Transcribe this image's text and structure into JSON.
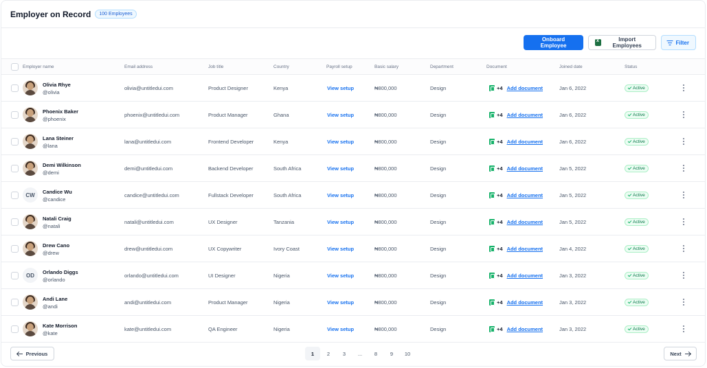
{
  "header": {
    "title": "Employer on Record",
    "badge": "100 Employees"
  },
  "toolbar": {
    "onboard_label": "Onboard Employee",
    "import_label": "Import Employees",
    "filter_label": "Filter"
  },
  "columns": {
    "employer_name": "Employer name",
    "email": "Email address",
    "job_title": "Job title",
    "country": "Country",
    "payroll": "Payroll setup",
    "salary": "Basic salary",
    "department": "Department",
    "document": "Document",
    "joined": "Joined date",
    "status": "Status"
  },
  "rows": [
    {
      "name": "Olivia Rhye",
      "handle": "@olivia",
      "avatar": "photo",
      "initials": "",
      "email": "olivia@untitledui.com",
      "job": "Product Designer",
      "country": "Kenya",
      "payroll": "View setup",
      "salary": "₦800,000",
      "department": "Design",
      "doc_count": "+4",
      "doc_link": "Add document",
      "joined": "Jan 6, 2022",
      "status": "Active"
    },
    {
      "name": "Phoenix Baker",
      "handle": "@phoenix",
      "avatar": "photo",
      "initials": "",
      "email": "phoenix@untitledui.com",
      "job": "Product Manager",
      "country": "Ghana",
      "payroll": "View setup",
      "salary": "₦800,000",
      "department": "Design",
      "doc_count": "+4",
      "doc_link": "Add document",
      "joined": "Jan 6, 2022",
      "status": "Active"
    },
    {
      "name": "Lana Steiner",
      "handle": "@lana",
      "avatar": "photo",
      "initials": "",
      "email": "lana@untitledui.com",
      "job": "Frontend Developer",
      "country": "Kenya",
      "payroll": "View setup",
      "salary": "₦800,000",
      "department": "Design",
      "doc_count": "+4",
      "doc_link": "Add document",
      "joined": "Jan 6, 2022",
      "status": "Active"
    },
    {
      "name": "Demi Wilkinson",
      "handle": "@demi",
      "avatar": "photo",
      "initials": "",
      "email": "demi@untitledui.com",
      "job": "Backend Developer",
      "country": "South Africa",
      "payroll": "View setup",
      "salary": "₦800,000",
      "department": "Design",
      "doc_count": "+4",
      "doc_link": "Add document",
      "joined": "Jan 5, 2022",
      "status": "Active"
    },
    {
      "name": "Candice Wu",
      "handle": "@candice",
      "avatar": "initials",
      "initials": "CW",
      "email": "candice@untitledui.com",
      "job": "Fullstack Developer",
      "country": "South Africa",
      "payroll": "View setup",
      "salary": "₦800,000",
      "department": "Design",
      "doc_count": "+4",
      "doc_link": "Add document",
      "joined": "Jan 5, 2022",
      "status": "Active"
    },
    {
      "name": "Natali Craig",
      "handle": "@natali",
      "avatar": "photo",
      "initials": "",
      "email": "natali@untitledui.com",
      "job": "UX Designer",
      "country": "Tanzania",
      "payroll": "View setup",
      "salary": "₦800,000",
      "department": "Design",
      "doc_count": "+4",
      "doc_link": "Add document",
      "joined": "Jan 5, 2022",
      "status": "Active"
    },
    {
      "name": "Drew Cano",
      "handle": "@drew",
      "avatar": "photo",
      "initials": "",
      "email": "drew@untitledui.com",
      "job": "UX Copywriter",
      "country": "Ivory Coast",
      "payroll": "View setup",
      "salary": "₦800,000",
      "department": "Design",
      "doc_count": "+4",
      "doc_link": "Add document",
      "joined": "Jan 4, 2022",
      "status": "Active"
    },
    {
      "name": "Orlando Diggs",
      "handle": "@orlando",
      "avatar": "initials",
      "initials": "OD",
      "email": "orlando@untitledui.com",
      "job": "UI Designer",
      "country": "Nigeria",
      "payroll": "View setup",
      "salary": "₦800,000",
      "department": "Design",
      "doc_count": "+4",
      "doc_link": "Add document",
      "joined": "Jan 3, 2022",
      "status": "Active"
    },
    {
      "name": "Andi Lane",
      "handle": "@andi",
      "avatar": "photo",
      "initials": "",
      "email": "andi@untitledui.com",
      "job": "Product Manager",
      "country": "Nigeria",
      "payroll": "View setup",
      "salary": "₦800,000",
      "department": "Design",
      "doc_count": "+4",
      "doc_link": "Add document",
      "joined": "Jan 3, 2022",
      "status": "Active"
    },
    {
      "name": "Kate Morrison",
      "handle": "@kate",
      "avatar": "photo",
      "initials": "",
      "email": "kate@untitledui.com",
      "job": "QA Engineer",
      "country": "Nigeria",
      "payroll": "View setup",
      "salary": "₦800,000",
      "department": "Design",
      "doc_count": "+4",
      "doc_link": "Add document",
      "joined": "Jan 3, 2022",
      "status": "Active"
    }
  ],
  "pagination": {
    "previous_label": "Previous",
    "next_label": "Next",
    "pages": [
      "1",
      "2",
      "3",
      "...",
      "8",
      "9",
      "10"
    ],
    "current": "1"
  },
  "icons": {
    "import": "excel-icon",
    "filter": "filter-lines-icon",
    "document": "document-icon",
    "status": "check-icon",
    "row_menu": "dots-vertical-icon",
    "previous": "arrow-left-icon",
    "next": "arrow-right-icon"
  },
  "colors": {
    "accent": "#1570ef",
    "status_green": "#067647",
    "status_bg": "#ecfdf3"
  }
}
